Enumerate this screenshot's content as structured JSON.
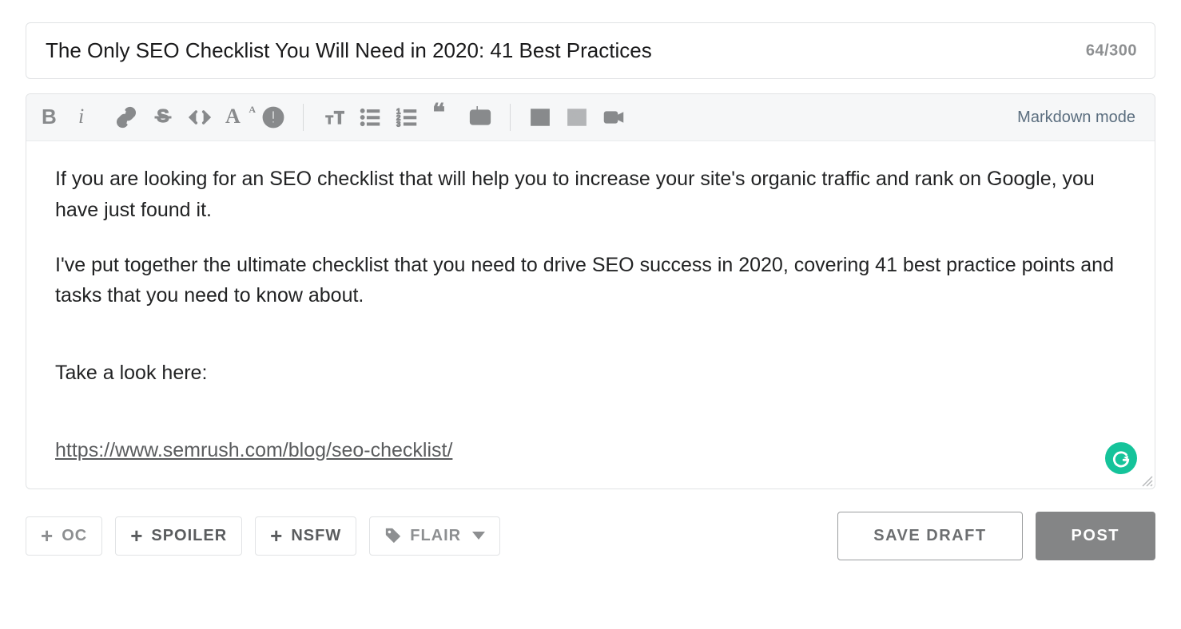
{
  "title": {
    "value": "The Only SEO Checklist You Will Need in 2020: 41 Best Practices",
    "count": "64/300"
  },
  "toolbar": {
    "markdown_link": "Markdown mode"
  },
  "body": {
    "para1": "If you are looking for an SEO checklist that will help you to increase your site's organic traffic and rank on Google, you have just found it.",
    "para2": "I've put together the ultimate checklist that you need to drive SEO success in 2020, covering 41 best practice points and tasks that you need to know about.",
    "para3": "Take a look here:",
    "link_text": "https://www.semrush.com/blog/seo-checklist/"
  },
  "tags": {
    "oc": "OC",
    "spoiler": "SPOILER",
    "nsfw": "NSFW",
    "flair": "FLAIR"
  },
  "actions": {
    "save_draft": "SAVE DRAFT",
    "post": "POST"
  }
}
